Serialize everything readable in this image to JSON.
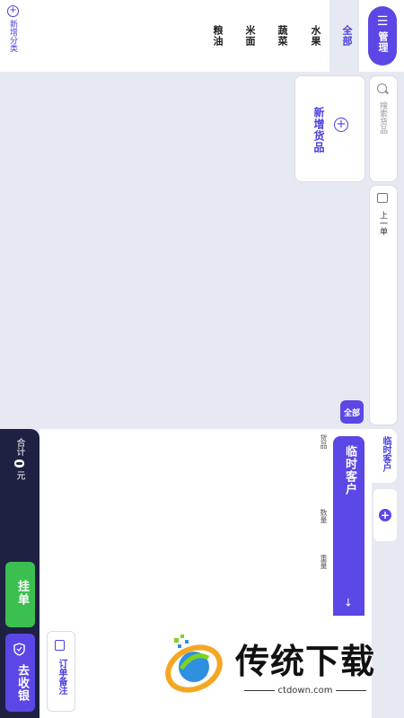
{
  "topbar": {
    "manage_label": "管理",
    "categories": [
      {
        "label": "全部",
        "active": true
      },
      {
        "label": "水果"
      },
      {
        "label": "蔬菜"
      },
      {
        "label": "米面"
      },
      {
        "label": "粮油"
      }
    ],
    "add_category_label": "新增分类"
  },
  "search": {
    "placeholder": "搜索货品"
  },
  "previous_order": {
    "label": "上一单"
  },
  "products": {
    "new_product_label": "新增货品"
  },
  "filter": {
    "all_label": "全部"
  },
  "customers": {
    "current_tab": "临时客户",
    "temp_customer_label": "临时客户",
    "arrow": "→"
  },
  "order": {
    "columns": [
      "货品",
      "数量",
      "重量"
    ]
  },
  "summary": {
    "total_prefix": "合计",
    "total_amount": "0",
    "currency": "元"
  },
  "actions": {
    "hang_label": "挂单",
    "pay_label": "去收银",
    "note_label": "订单备注"
  },
  "watermark": {
    "title": "传统下载",
    "url": "ctdown.com"
  },
  "colors": {
    "accent": "#5a47e6",
    "dark": "#1f2142",
    "green": "#3bbf50",
    "background": "#e6e9f1"
  }
}
